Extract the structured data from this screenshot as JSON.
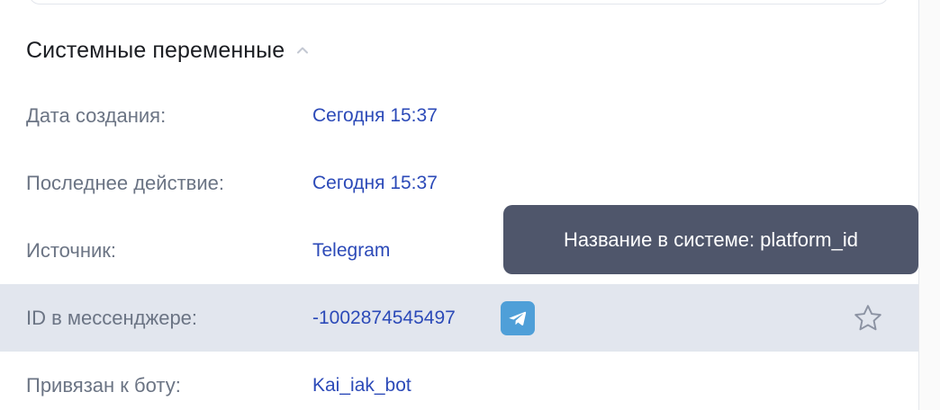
{
  "section": {
    "title": "Системные переменные",
    "collapse_icon": "chevron-up-icon"
  },
  "rows": [
    {
      "label": "Дата создания:",
      "value": "Сегодня 15:37"
    },
    {
      "label": "Последнее действие:",
      "value": "Сегодня 15:37"
    },
    {
      "label": "Источник:",
      "value": "Telegram"
    },
    {
      "label": "ID в мессенджере:",
      "value": "-1002874545497",
      "icon": "telegram-icon",
      "action_icon": "star-icon",
      "highlighted": true
    },
    {
      "label": "Привязан к боту:",
      "value": "Kai_iak_bot"
    }
  ],
  "tooltip": {
    "text": "Название в системе: platform_id"
  },
  "colors": {
    "value_link": "#2c4ab8",
    "label": "#6b7484",
    "highlight_row": "#e2e6ee",
    "tooltip_bg": "#4f566b",
    "telegram": "#4f9fd8"
  }
}
